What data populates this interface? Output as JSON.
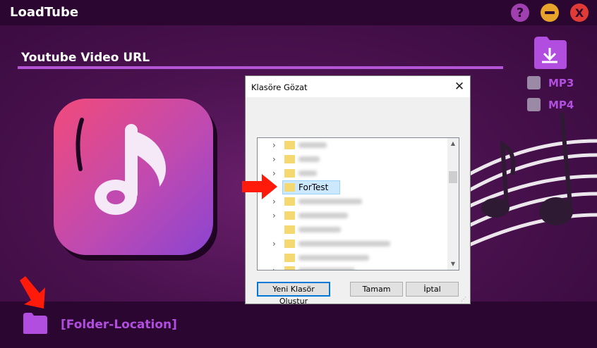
{
  "app": {
    "title": "LoadTube",
    "help_label": "?",
    "close_label": "X"
  },
  "main": {
    "url_label": "Youtube Video URL",
    "format_options": [
      {
        "label": "MP3",
        "checked": false
      },
      {
        "label": "MP4",
        "checked": false
      }
    ],
    "folder_location": "[Folder-Location]"
  },
  "dialog": {
    "title": "Klasöre Gözat",
    "close_label": "✕",
    "selected_folder": "ForTest",
    "buttons": {
      "new_folder": "Yeni Klasör Oluştur",
      "ok": "Tamam",
      "cancel": "İptal"
    }
  },
  "colors": {
    "accent": "#b14ee0",
    "titlebar": "#2b0631",
    "selection": "#cce8ff",
    "annotation_arrow": "#ff1a0a"
  },
  "icons": [
    "help-icon",
    "minimize-icon",
    "close-icon",
    "folder-download-icon",
    "music-note-icon",
    "folder-icon",
    "chevron-right-icon",
    "arrow-icon"
  ]
}
